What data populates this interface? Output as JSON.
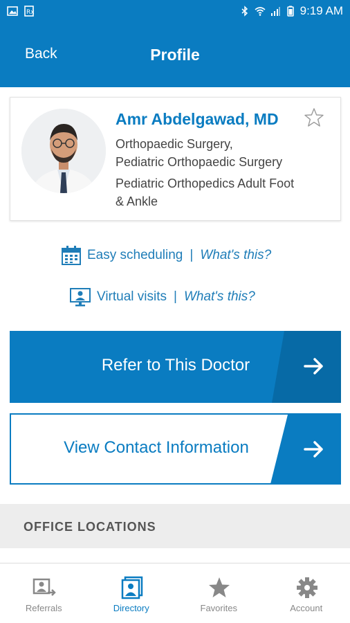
{
  "status_bar": {
    "time": "9:19 AM"
  },
  "header": {
    "back_label": "Back",
    "title": "Profile"
  },
  "doctor": {
    "name": "Amr Abdelgawad, MD",
    "specialty_line1": "Orthopaedic Surgery,",
    "specialty_line2": "Pediatric Orthopaedic Surgery",
    "subspecialty_line1": "Pediatric Orthopedics Adult Foot",
    "subspecialty_line2": "& Ankle"
  },
  "features": {
    "scheduling": {
      "label": "Easy scheduling",
      "separator": "|",
      "link": "What's this?"
    },
    "virtual": {
      "label": "Virtual visits",
      "separator": "|",
      "link": "What's this?"
    }
  },
  "actions": {
    "refer_label": "Refer to This Doctor",
    "contact_label": "View Contact Information"
  },
  "office": {
    "title": "OFFICE LOCATIONS"
  },
  "nav": {
    "items": [
      {
        "label": "Referrals",
        "icon": "referrals-icon"
      },
      {
        "label": "Directory",
        "icon": "directory-icon"
      },
      {
        "label": "Favorites",
        "icon": "star-icon"
      },
      {
        "label": "Account",
        "icon": "gear-icon"
      }
    ],
    "active": "Directory"
  },
  "colors": {
    "brand": "#0a7cc1",
    "brand_dark": "#076aa6",
    "nav_inactive": "#888888"
  }
}
